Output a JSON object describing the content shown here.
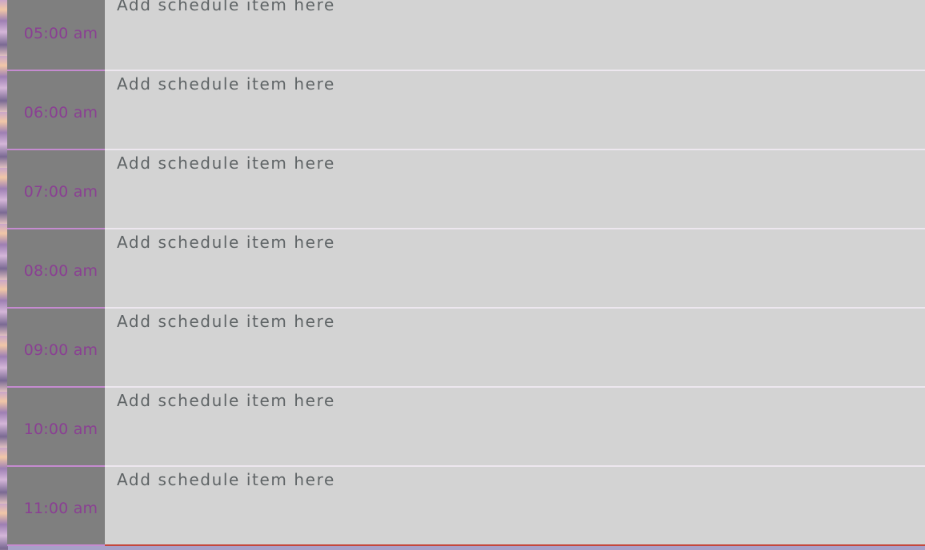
{
  "schedule": {
    "rows": [
      {
        "time": "05:00 am",
        "placeholder": "Add schedule item here"
      },
      {
        "time": "06:00 am",
        "placeholder": "Add schedule item here"
      },
      {
        "time": "07:00 am",
        "placeholder": "Add schedule item here"
      },
      {
        "time": "08:00 am",
        "placeholder": "Add schedule item here"
      },
      {
        "time": "09:00 am",
        "placeholder": "Add schedule item here"
      },
      {
        "time": "10:00 am",
        "placeholder": "Add schedule item here"
      },
      {
        "time": "11:00 am",
        "placeholder": "Add schedule item here"
      }
    ]
  },
  "colors": {
    "time_text": "#8a3f93",
    "time_block": "#7f7f7f",
    "slot_background": "#d3d3d3",
    "slot_text": "#5f6466"
  }
}
